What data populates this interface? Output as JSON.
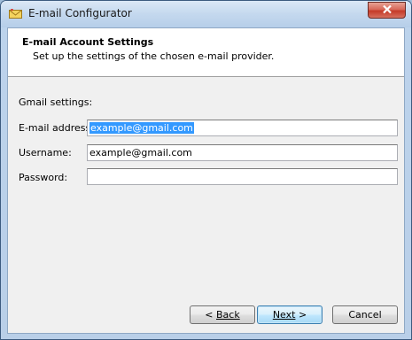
{
  "window": {
    "title": "E-mail Configurator"
  },
  "header": {
    "title": "E-mail Account Settings",
    "subtitle": "Set up the settings of the chosen e-mail provider."
  },
  "form": {
    "section_label": "Gmail settings:",
    "email_label": "E-mail address:",
    "email_value": "example@gmail.com",
    "username_label": "Username:",
    "username_value": "example@gmail.com",
    "password_label": "Password:",
    "password_value": ""
  },
  "buttons": {
    "back_prefix": "< ",
    "back_label": "Back",
    "next_label": "Next",
    "next_suffix": " >",
    "cancel_label": "Cancel"
  },
  "colors": {
    "selection": "#3399ff",
    "close_button": "#c53a28"
  },
  "icons": {
    "app": "envelope-icon",
    "close": "close-icon"
  }
}
